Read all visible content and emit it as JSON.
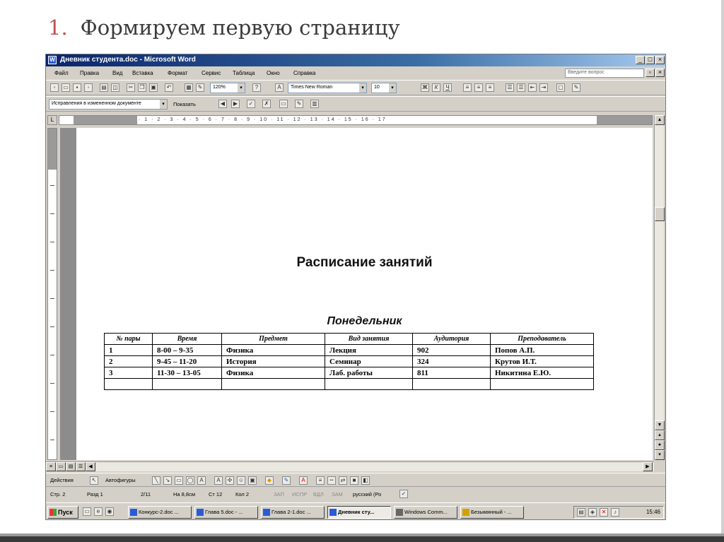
{
  "slide": {
    "number": "1.",
    "heading": "Формируем первую страницу"
  },
  "window": {
    "title": "Дневник студента.doc - Microsoft Word",
    "controls": {
      "minimize": "_",
      "maximize": "□",
      "close": "×"
    },
    "doc_controls": {
      "minimize": "_",
      "restore": "▫",
      "close": "×"
    }
  },
  "menu": {
    "items": [
      "Файл",
      "Правка",
      "Вид",
      "Вставка",
      "Формат",
      "Сервис",
      "Таблица",
      "Окно",
      "Справка"
    ],
    "question_placeholder": "Введите вопрос"
  },
  "toolbar": {
    "zoom": "120%",
    "font": "Times New Roman",
    "font_size": "10",
    "bold": "Ж",
    "italic": "К",
    "underline": "Ч",
    "tracking_mode": "Исправления в измененном документе",
    "show_label": "Показать"
  },
  "ruler": {
    "ticks": "· 1 · 2 · 3 · 4 · 5 · 6 · 7 · 8 · 9 · 10 · 11 · 12 · 13 · 14 · 15 · 16 · 17"
  },
  "document": {
    "title": "Расписание занятий",
    "day": "Понедельник",
    "table": {
      "headers": [
        "№ пары",
        "Время",
        "Предмет",
        "Вид занятия",
        "Аудитория",
        "Преподаватель"
      ],
      "rows": [
        [
          "1",
          "8-00 – 9-35",
          "Физика",
          "Лекция",
          "902",
          "Попов А.П."
        ],
        [
          "2",
          "9-45 – 11-20",
          "История",
          "Семинар",
          "324",
          "Крутов И.Т."
        ],
        [
          "3",
          "11-30 – 13-05",
          "Физика",
          "Лаб. работы",
          "811",
          "Никитина Е.Ю."
        ],
        [
          "",
          "",
          "",
          "",
          "",
          ""
        ]
      ]
    }
  },
  "drawing": {
    "actions": "Действия",
    "autoshapes": "Автофигуры"
  },
  "status": {
    "page": "Стр. 2",
    "section": "Разд 1",
    "pages": "2/11",
    "at": "На 8,8см",
    "line": "Ст 12",
    "col": "Кол 2",
    "rec": "ЗАП",
    "trk": "ИСПР",
    "ext": "ВДЛ",
    "ovr": "ЗАМ",
    "lang": "русский (Ро"
  },
  "taskbar": {
    "start": "Пуск",
    "tasks": [
      "Конкурс-2.doc ...",
      "Глава 5.doc - ...",
      "Глава 2-1.doc ...",
      "Дневник сту...",
      "Windows Comm...",
      "Безымянный - ..."
    ],
    "clock": "15:46"
  }
}
